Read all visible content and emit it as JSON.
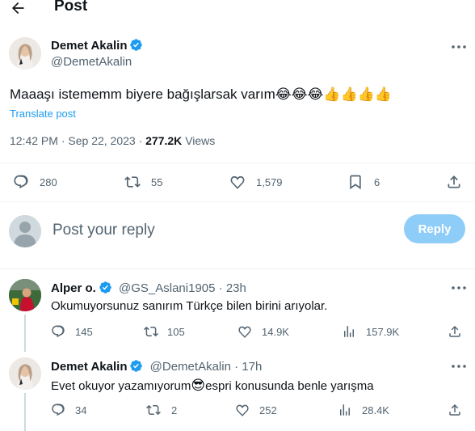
{
  "header": {
    "title": "Post",
    "back_icon": "arrow-left-icon"
  },
  "post": {
    "author_name": "Demet Akalin",
    "author_handle": "@DemetAkalin",
    "text": "Maaaşı istememm biyere bağışlarsak varım",
    "emojis": "😂😂😂👍👍👍👍",
    "translate_label": "Translate post",
    "time": "12:42 PM",
    "date": "Sep 22, 2023",
    "views_count": "277.2K",
    "views_label": "Views",
    "stats": {
      "replies": "280",
      "reposts": "55",
      "likes": "1,579",
      "bookmarks": "6"
    }
  },
  "reply_box": {
    "placeholder": "Post your reply",
    "button_label": "Reply"
  },
  "replies": [
    {
      "author_name": "Alper o.",
      "author_handle": "@GS_Aslani1905",
      "separator": "·",
      "time": "23h",
      "text": "Okumuyorsunuz sanırım Türkçe bilen birini arıyolar.",
      "stats": {
        "replies": "145",
        "reposts": "105",
        "likes": "14.9K",
        "views": "157.9K"
      }
    },
    {
      "author_name": "Demet Akalin",
      "author_handle": "@DemetAkalin",
      "separator": "·",
      "time": "17h",
      "text_before": "Evet okuyor yazamıyorum",
      "emoji": "😎",
      "text_after": "espri konusunda benle yarışma",
      "stats": {
        "replies": "34",
        "reposts": "2",
        "likes": "252",
        "views": "28.4K"
      }
    }
  ],
  "colors": {
    "accent": "#1d9bf0",
    "muted": "#536471",
    "reply_button": "#8ecdf8",
    "divider": "#eff3f4"
  }
}
